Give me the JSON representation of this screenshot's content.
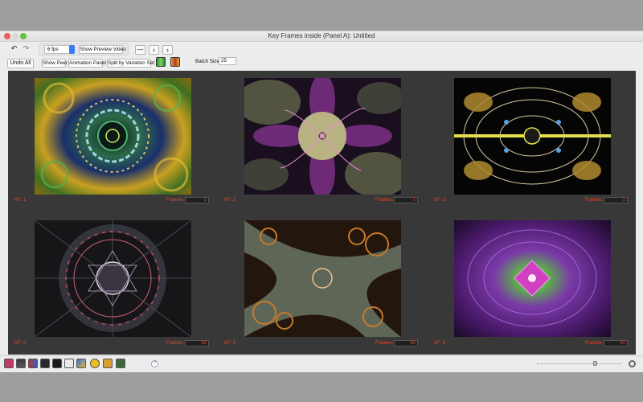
{
  "window": {
    "title": "Key Frames inside (Panel A): Untitled"
  },
  "toolbar": {
    "undo_all": "Undo All",
    "fps": "6 fps",
    "show_preview_video": "Show Preview Video",
    "show_peer": "Show Peer",
    "animation_panel": "Animation Panel",
    "split_by_variation_set": "Split by Variation Set",
    "batch_size_label": "Batch Size:",
    "batch_size_value": "25"
  },
  "frames_label": "Frames:",
  "keyframes": [
    {
      "label": "KF:  1",
      "frames": "1"
    },
    {
      "label": "KF:  2",
      "frames": "1"
    },
    {
      "label": "KF:  3",
      "frames": "1"
    },
    {
      "label": "KF:  4",
      "frames": "60"
    },
    {
      "label": "KF:  5",
      "frames": "60"
    },
    {
      "label": "KF:  6",
      "frames": "60"
    }
  ],
  "bottombar": {
    "help": "?"
  },
  "icons": [
    "undo-icon",
    "redo-icon",
    "minus-icon",
    "chevron-left-icon",
    "chevron-right-icon",
    "film-strip-icon",
    "color-strip-icon",
    "home-icon",
    "grid-icon",
    "palette-grid-icon",
    "eye-icon",
    "info-icon",
    "text-icon",
    "star-cube-icon",
    "star-icon",
    "star-badge-icon",
    "chip-icon",
    "gear-icon"
  ]
}
